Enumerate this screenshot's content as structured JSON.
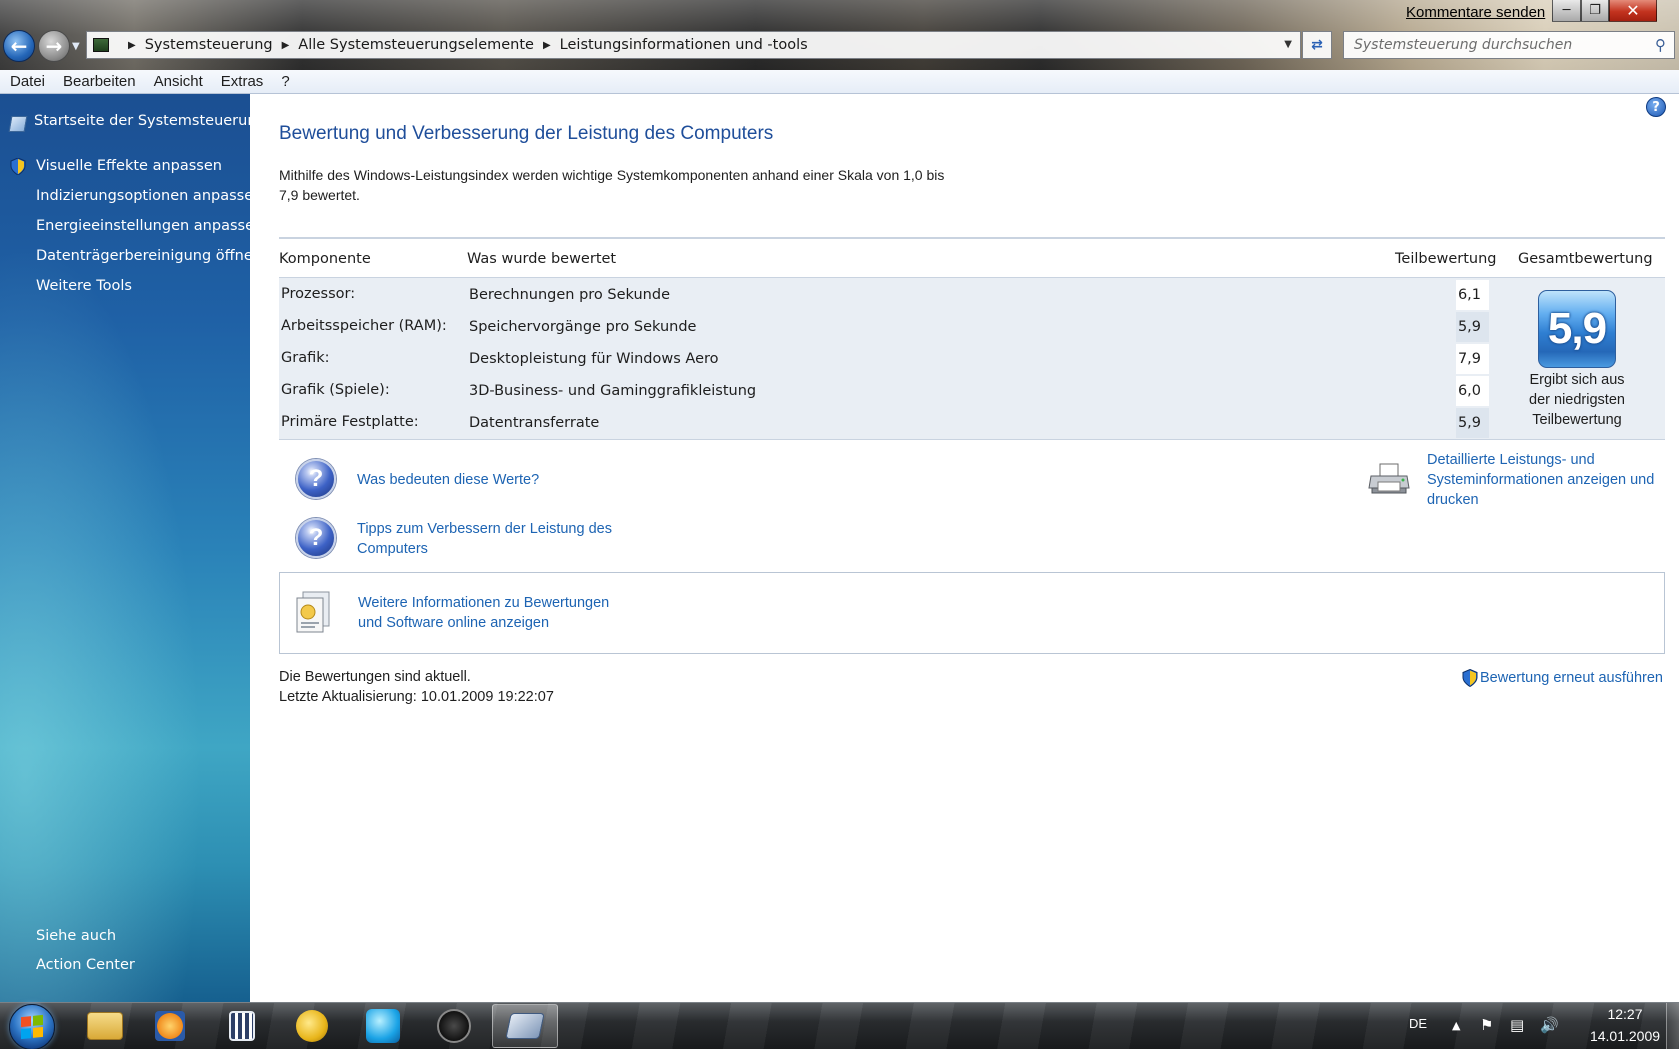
{
  "window": {
    "feedback_link": "Kommentare senden",
    "breadcrumb": [
      "Systemsteuerung",
      "Alle Systemsteuerungselemente",
      "Leistungsinformationen und -tools"
    ],
    "search_placeholder": "Systemsteuerung durchsuchen"
  },
  "menu": [
    "Datei",
    "Bearbeiten",
    "Ansicht",
    "Extras",
    "?"
  ],
  "sidebar": {
    "home": "Startseite der Systemsteuerung",
    "tasks": [
      "Visuelle Effekte anpassen",
      "Indizierungsoptionen anpassen",
      "Energieeinstellungen anpassen",
      "Datenträgerbereinigung öffnen",
      "Weitere Tools"
    ],
    "see_also_label": "Siehe auch",
    "see_also": [
      "Action Center"
    ]
  },
  "main": {
    "title": "Bewertung und Verbesserung der Leistung des Computers",
    "intro_line1": "Mithilfe des Windows-Leistungsindex werden wichtige Systemkomponenten anhand einer Skala von 1,0 bis",
    "intro_line2": "7,9 bewertet.",
    "table": {
      "headers": [
        "Komponente",
        "Was wurde bewertet",
        "Teilbewertung",
        "Gesamtbewertung"
      ],
      "rows": [
        {
          "component": "Prozessor:",
          "what": "Berechnungen pro Sekunde",
          "score": "6,1"
        },
        {
          "component": "Arbeitsspeicher (RAM):",
          "what": "Speichervorgänge pro Sekunde",
          "score": "5,9"
        },
        {
          "component": "Grafik:",
          "what": "Desktopleistung für Windows Aero",
          "score": "7,9"
        },
        {
          "component": "Grafik (Spiele):",
          "what": "3D-Business- und Gaminggrafikleistung",
          "score": "6,0"
        },
        {
          "component": "Primäre Festplatte:",
          "what": "Datentransferrate",
          "score": "5,9"
        }
      ],
      "base_score": "5,9",
      "base_caption": [
        "Ergibt sich aus",
        "der niedrigsten",
        "Teilbewertung"
      ]
    },
    "links": {
      "what_mean": "Was bedeuten diese Werte?",
      "tips_line1": "Tipps zum Verbessern der Leistung des",
      "tips_line2": "Computers",
      "details_line1": "Detaillierte Leistungs- und",
      "details_line2": "Systeminformationen anzeigen und",
      "details_line3": "drucken",
      "more_info_line1": "Weitere Informationen zu Bewertungen",
      "more_info_line2": "und Software online anzeigen",
      "rerun": "Bewertung erneut ausführen"
    },
    "status": "Die Bewertungen sind aktuell.",
    "last_update": "Letzte Aktualisierung: 10.01.2009 19:22:07"
  },
  "taskbar": {
    "language": "DE",
    "time": "12:27",
    "date": "14.01.2009"
  },
  "colors": {
    "link": "#1d64b3",
    "title": "#1f4e9a",
    "sidebar_top": "#1b4f92",
    "sidebar_bottom": "#16608f"
  }
}
